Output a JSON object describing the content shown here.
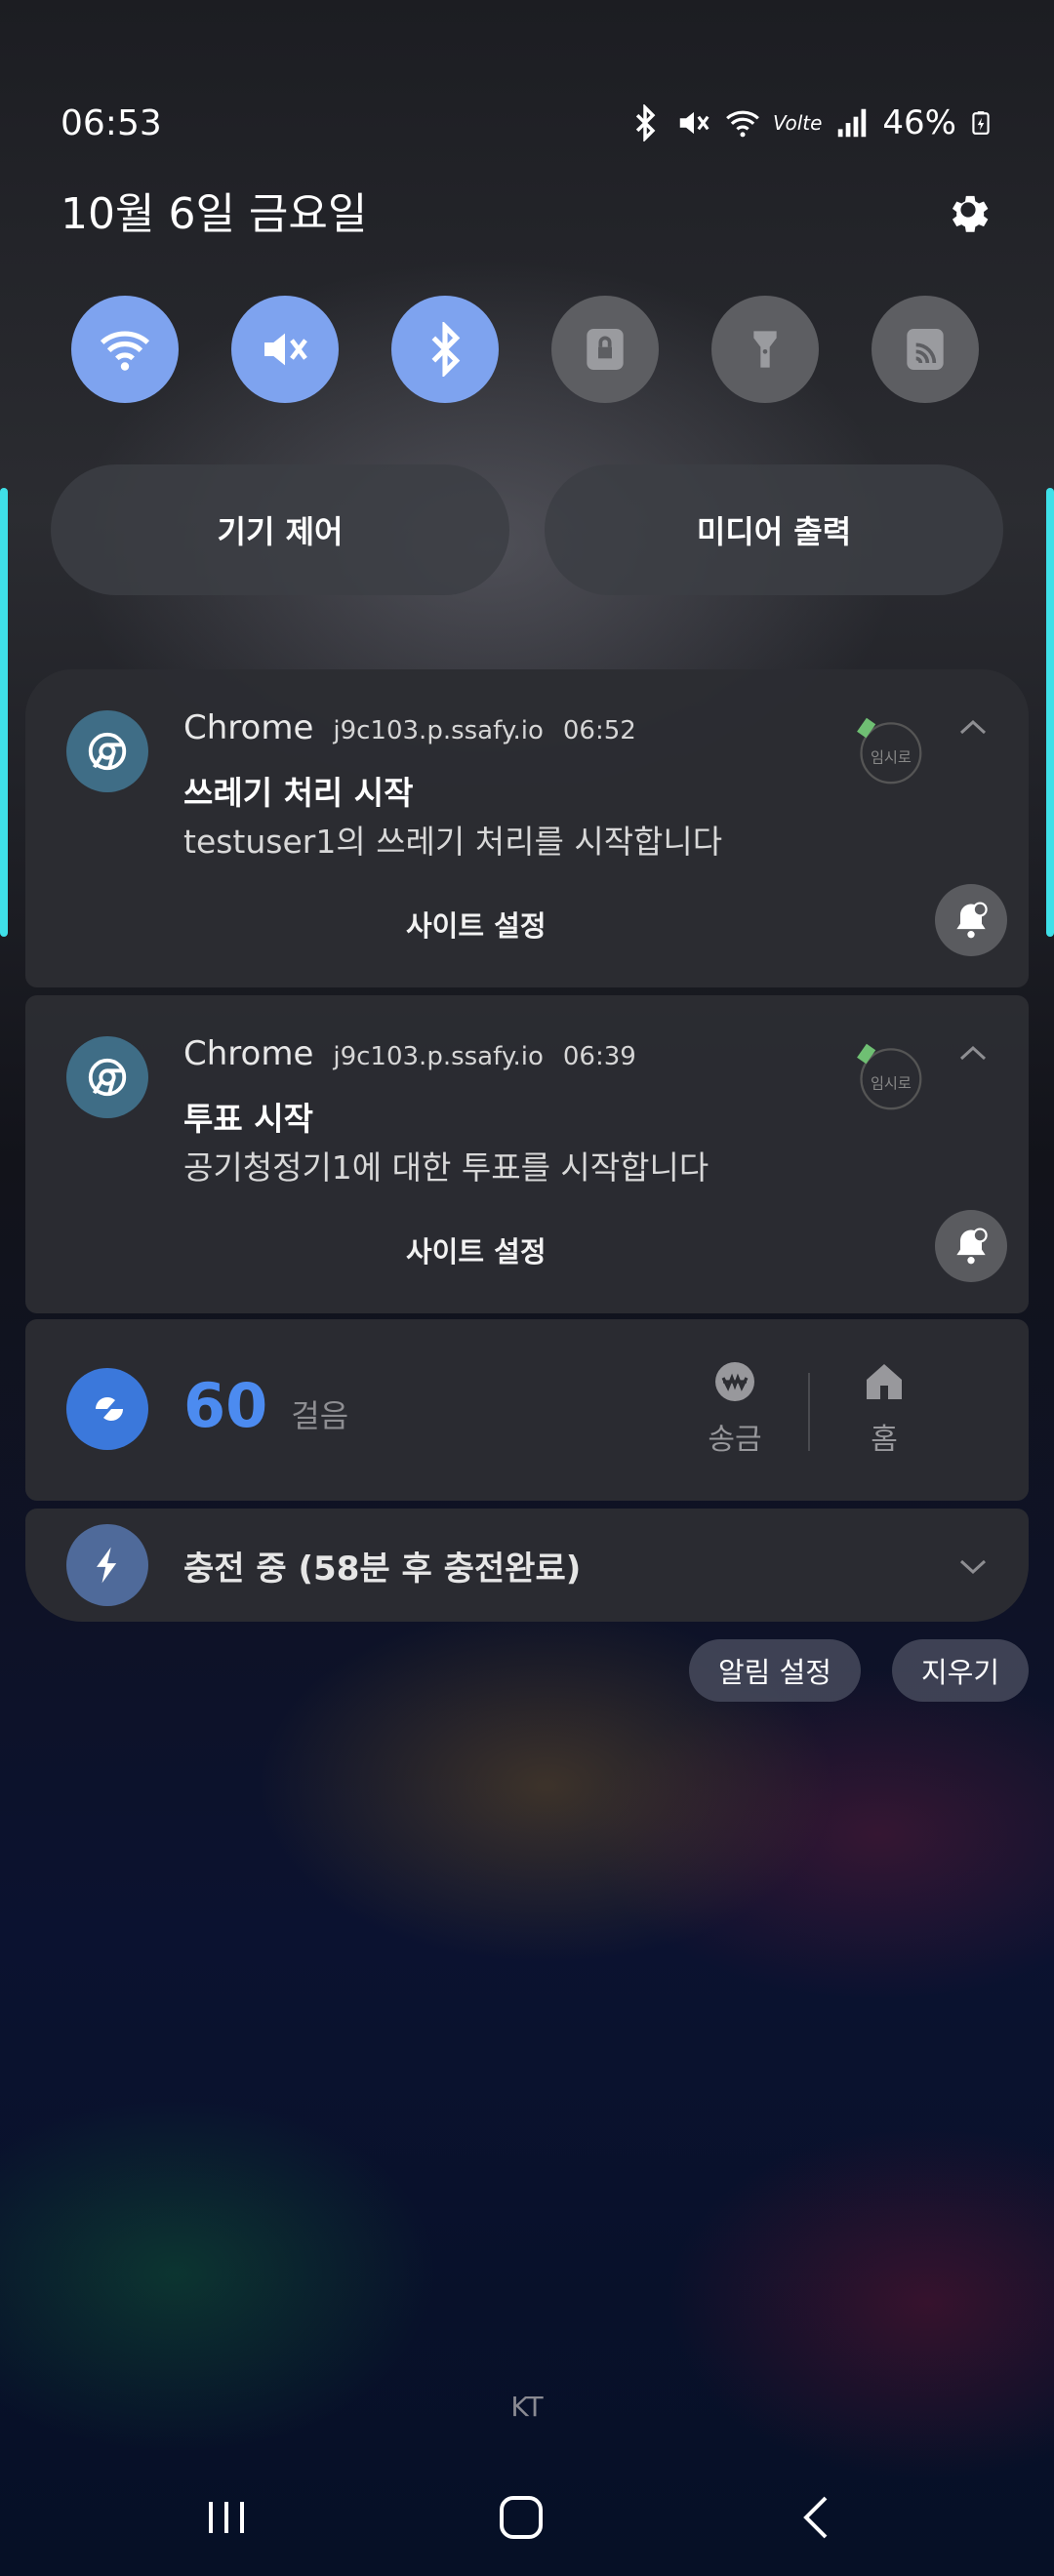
{
  "status_bar": {
    "time": "06:53",
    "battery": "46%",
    "network": "Volte"
  },
  "header": {
    "date": "10월 6일 금요일"
  },
  "quick_tiles": [
    {
      "name": "wifi-icon",
      "state": "on"
    },
    {
      "name": "mute-icon",
      "state": "on"
    },
    {
      "name": "bluetooth-icon",
      "state": "on"
    },
    {
      "name": "lock-icon",
      "state": "off"
    },
    {
      "name": "flashlight-icon",
      "state": "off"
    },
    {
      "name": "cast-icon",
      "state": "off"
    }
  ],
  "pills": {
    "device_control": "기기 제어",
    "media_output": "미디어 출력"
  },
  "notifications": [
    {
      "app": "Chrome",
      "site": "j9c103.p.ssafy.io",
      "time": "06:52",
      "title": "쓰레기 처리 시작",
      "body": "testuser1의 쓰레기 처리를 시작합니다",
      "action": "사이트 설정"
    },
    {
      "app": "Chrome",
      "site": "j9c103.p.ssafy.io",
      "time": "06:39",
      "title": "투표 시작",
      "body": "공기청정기1에 대한 투표를 시작합니다",
      "action": "사이트 설정"
    }
  ],
  "stamp_text": "임시로",
  "steps": {
    "count": "60",
    "unit": "걸음",
    "send_label": "송금",
    "home_label": "홈"
  },
  "charging": {
    "text": "충전 중 (58분 후 충전완료)"
  },
  "buttons": {
    "notification_settings": "알림 설정",
    "clear": "지우기"
  },
  "carrier": "KT",
  "colors": {
    "tile_on": "#7ea3ef",
    "tile_off": "#5d5e62",
    "accent": "#4c8bf0",
    "edge_light": "#3fe0e8"
  }
}
